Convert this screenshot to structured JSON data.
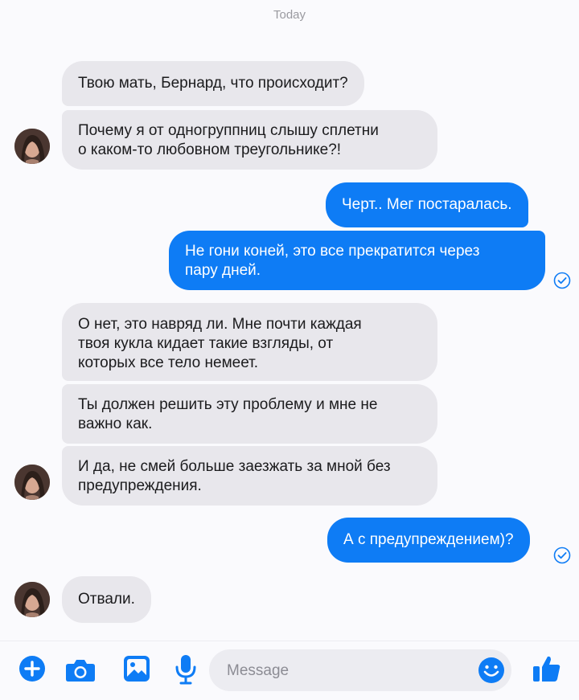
{
  "chat": {
    "date_label": "Today",
    "messages": [
      {
        "direction": "incoming",
        "text": "Твою мать, Бернард, что происходит?"
      },
      {
        "direction": "incoming",
        "text": "Почему я от одногруппниц слышу сплетни\nо каком-то любовном треугольнике?!"
      },
      {
        "direction": "outgoing",
        "text": "Черт.. Мег постаралась."
      },
      {
        "direction": "outgoing",
        "text": "Не гони коней, это все прекратится через\nпару дней."
      },
      {
        "direction": "incoming",
        "text": "О нет, это навряд ли. Мне почти каждая\nтвоя кукла кидает такие взгляды, от\nкоторых все тело немеет."
      },
      {
        "direction": "incoming",
        "text": "Ты должен решить эту проблему и мне не\nважно как."
      },
      {
        "direction": "incoming",
        "text": "И да, не смей больше заезжать за мной без\nпредупреждения."
      },
      {
        "direction": "outgoing",
        "text": "А с предупреждением)?"
      },
      {
        "direction": "incoming",
        "text": "Отвали."
      }
    ]
  },
  "composer": {
    "placeholder": "Message",
    "icons": [
      "plus-icon",
      "camera-icon",
      "image-icon",
      "microphone-icon",
      "emoji-icon",
      "thumbs-up-icon"
    ]
  },
  "colors": {
    "outgoing_bubble": "#0e7cf5",
    "incoming_bubble": "#e8e7ec",
    "accent": "#0e7cf5"
  }
}
